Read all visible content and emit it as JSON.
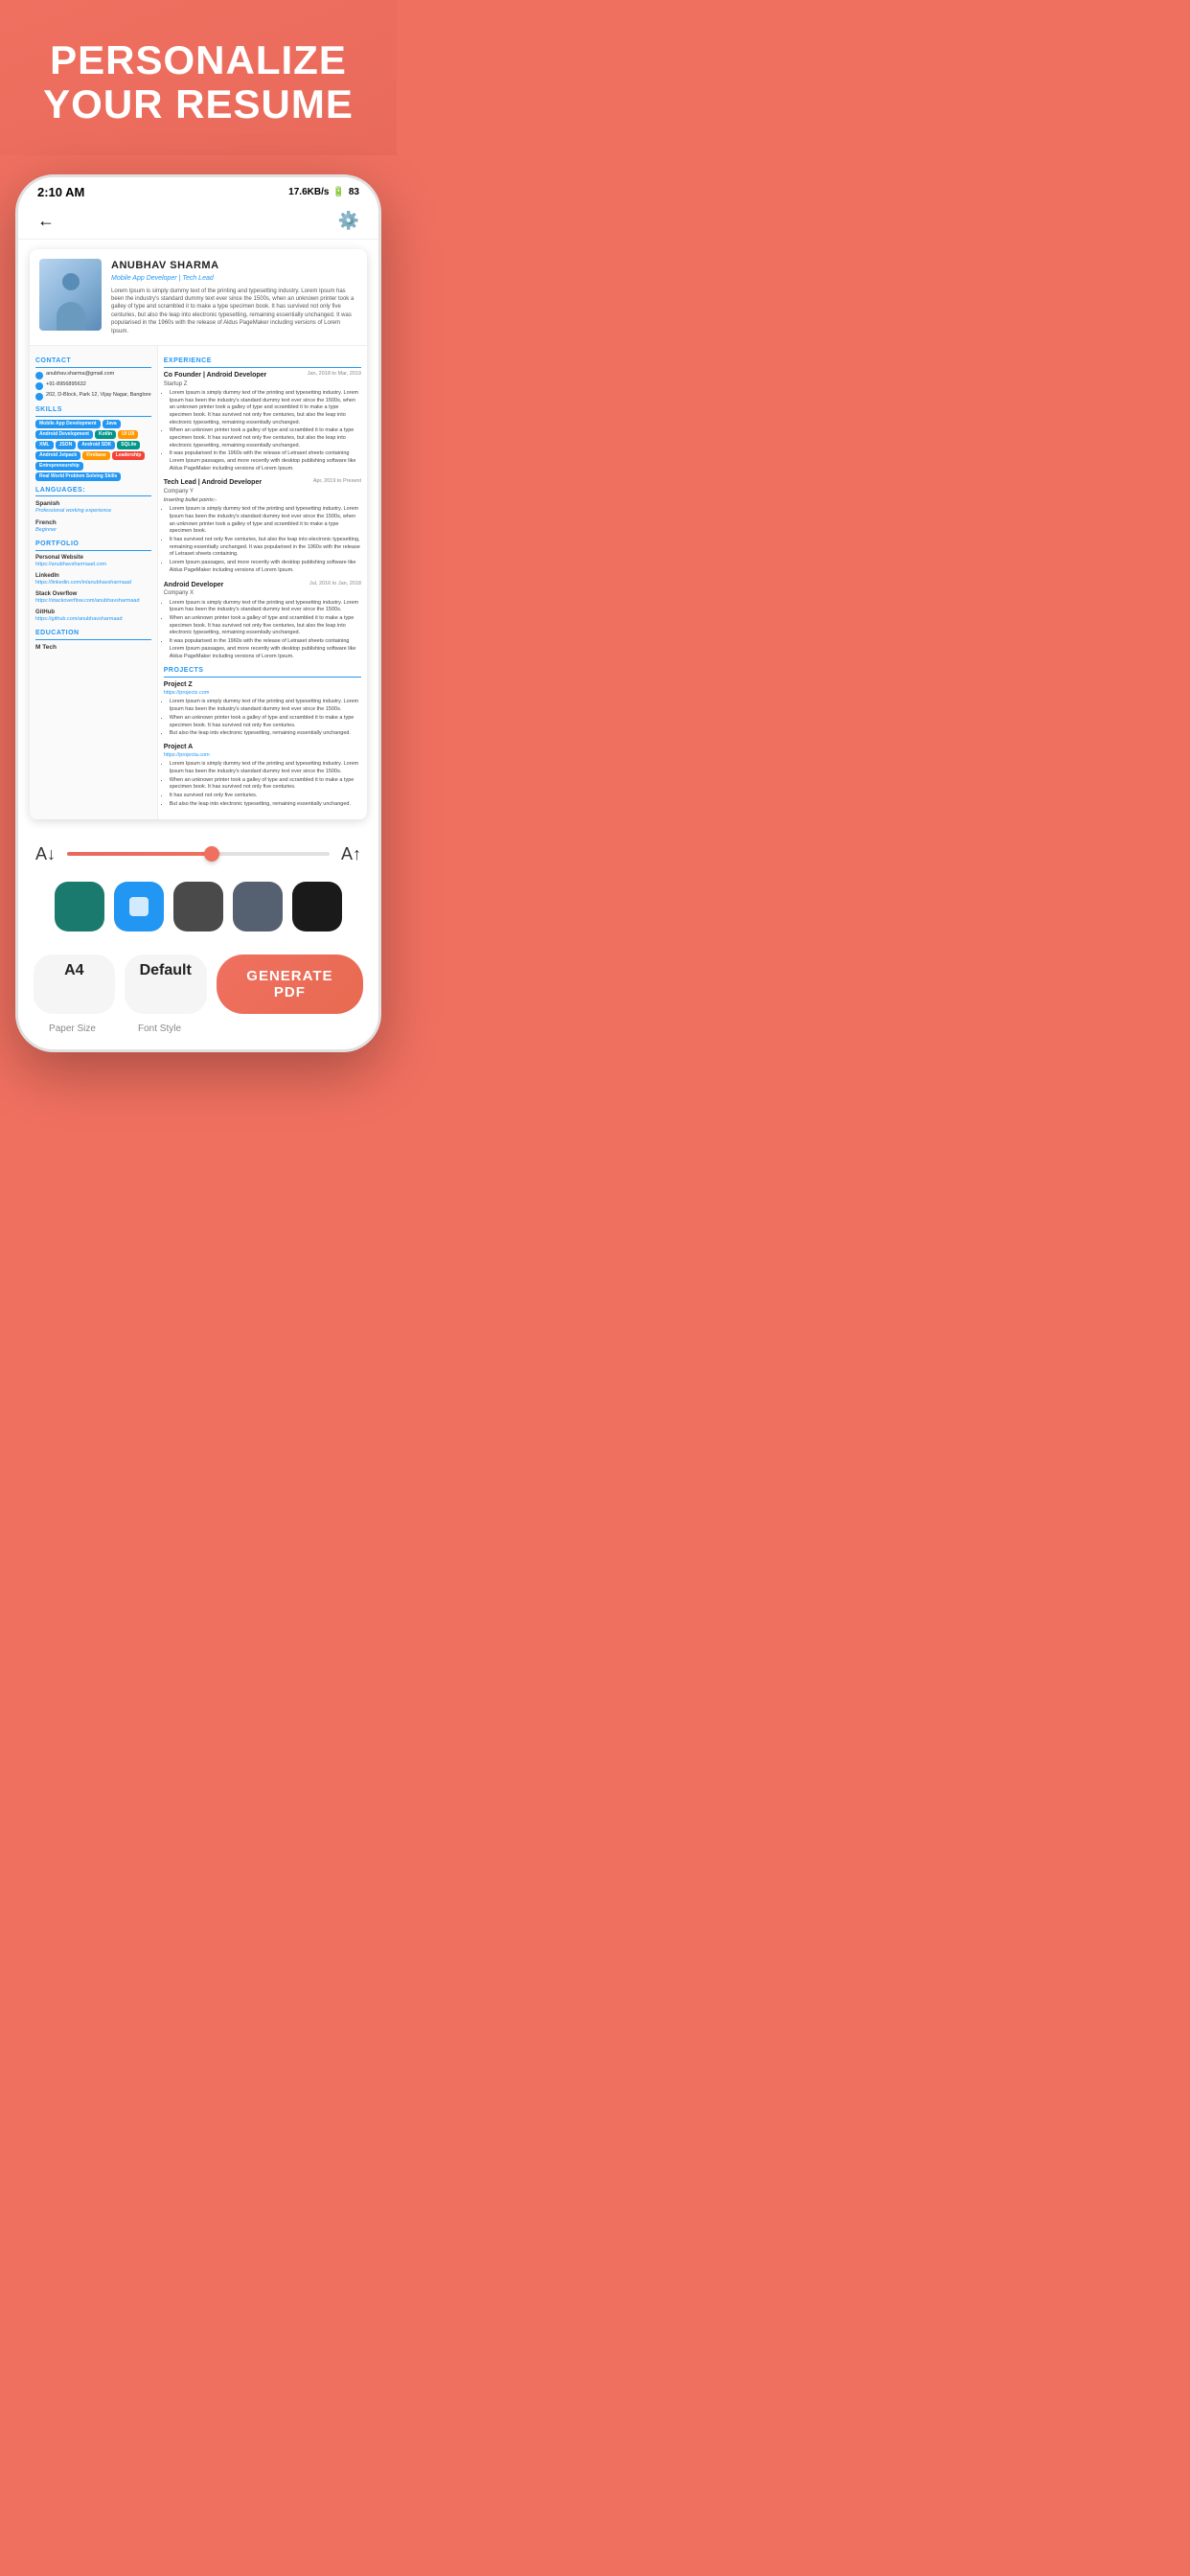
{
  "hero": {
    "title": "PERSONALIZE YOUR RESUME"
  },
  "statusBar": {
    "time": "2:10 AM",
    "speed": "17.6KB/s",
    "battery": "83"
  },
  "resume": {
    "name": "ANUBHAV SHARMA",
    "title": "Mobile App Developer | Tech Lead",
    "summary": "Lorem Ipsum is simply dummy text of the printing and typesetting industry. Lorem Ipsum has been the industry's standard dummy text ever since the 1500s, when an unknown printer took a galley of type and scrambled it to make a type specimen book. It has survived not only five centuries, but also the leap into electronic typesetting, remaining essentially unchanged. It was popularised in the 1960s with the release of Aldus PageMaker including versions of Lorem Ipsum.",
    "contact": {
      "label": "CONTACT",
      "email": "anubhav.sharma@gmail.com",
      "phone": "+91-8956895632",
      "address": "202, D-Block, Park 12, Vijay Nagar, Banglore"
    },
    "skills": {
      "label": "SKILLS",
      "tags": [
        {
          "text": "Mobile App Development",
          "color": "blue"
        },
        {
          "text": "Java",
          "color": "blue"
        },
        {
          "text": "Android Development",
          "color": "blue"
        },
        {
          "text": "Kotlin",
          "color": "teal"
        },
        {
          "text": "UI UX",
          "color": "orange"
        },
        {
          "text": "XML",
          "color": "blue"
        },
        {
          "text": "JSON",
          "color": "blue"
        },
        {
          "text": "Android SDK",
          "color": "blue"
        },
        {
          "text": "SQLite",
          "color": "teal"
        },
        {
          "text": "Android Jetpack",
          "color": "blue"
        },
        {
          "text": "Firebase",
          "color": "orange"
        },
        {
          "text": "Leadership",
          "color": "red"
        },
        {
          "text": "Entrepreneurship",
          "color": "blue"
        },
        {
          "text": "Real World Problem Solving Skills",
          "color": "blue"
        }
      ]
    },
    "languages": {
      "label": "LANGUAGES:",
      "items": [
        {
          "name": "Spanish",
          "level": "Professional working experience"
        },
        {
          "name": "French",
          "level": "Beginner"
        }
      ]
    },
    "portfolio": {
      "label": "PORTFOLIO",
      "items": [
        {
          "label": "Personal Website",
          "link": "https://anubhavsharmaad.com"
        },
        {
          "label": "LinkedIn",
          "link": "https://linkedin.com/in/anubhavsharmaad"
        },
        {
          "label": "Stack Overflow",
          "link": "https://stackoverflow.com/anubhavsharmaad"
        },
        {
          "label": "GitHub",
          "link": "https://github.com/anubhavsharmaad"
        }
      ]
    },
    "education": {
      "label": "EDUCATION",
      "degree": "M Tech"
    },
    "experience": {
      "label": "EXPERIENCE",
      "items": [
        {
          "role": "Co Founder | Android Developer",
          "company": "Startup Z",
          "date": "Jan, 2018 to Mar, 2019",
          "bullets": [
            "Lorem Ipsum is simply dummy text of the printing and typesetting industry. Lorem Ipsum has been the industry's standard dummy text ever since the 1500s, when an unknown printer took a galley of type and scrambled it to make a type specimen book. It has survived not only five centuries, but also the leap into electronic typesetting, remaining essentially unchanged.",
            "When an unknown printer took a galley of type and scrambled it to make a type specimen book. It has survived not only five centuries, but also the leap into electronic typesetting, remaining essentially unchanged.",
            "It was popularised in the 1960s with the release of Letraset sheets containing Lorem Ipsum passages, and more recently with desktop publishing software like Aldus PageMaker including versions of Lorem Ipsum."
          ]
        },
        {
          "role": "Tech Lead | Android Developer",
          "company": "Company Y",
          "date": "Apr, 2019 to Present",
          "note": "Inserting bullet points:-",
          "bullets": [
            "Lorem Ipsum is simply dummy text of the printing and typesetting industry. Lorem Ipsum has been the industry's standard dummy text ever since the 1500s, when an unknown printer took a galley of type and scrambled it to make a type specimen book.",
            "It has survived not only five centuries, but also the leap into electronic typesetting, remaining essentially unchanged. It was popularised in the 1960s with the release of Letraset sheets containing.",
            "Lorem Ipsum passages, and more recently with desktop publishing software like Aldus PageMaker including versions of Lorem Ipsum."
          ]
        },
        {
          "role": "Android Developer",
          "company": "Company X",
          "date": "Jul, 2016 to Jan, 2018",
          "bullets": [
            "Lorem Ipsum is simply dummy text of the printing and typesetting industry. Lorem Ipsum has been the industry's standard dummy text ever since the 1500s.",
            "When an unknown printer took a galley of type and scrambled it to make a type specimen book. It has survived not only five centuries, but also the leap into electronic typesetting, remaining essentially unchanged.",
            "It was popularised in the 1960s with the release of Letraset sheets containing Lorem Ipsum passages, and more recently with desktop publishing software like Aldus PageMaker including versions of Lorem Ipsum."
          ]
        }
      ]
    },
    "projects": {
      "label": "PROJECTS",
      "items": [
        {
          "name": "Project Z",
          "link": "https://projectz.com",
          "bullets": [
            "Lorem Ipsum is simply dummy text of the printing and typesetting industry. Lorem Ipsum has been the industry's standard dummy text ever since the 1500s.",
            "When an unknown printer took a galley of type and scrambled it to make a type specimen book. It has survived not only five centuries.",
            "But also the leap into electronic typesetting, remaining essentially unchanged."
          ]
        },
        {
          "name": "Project A",
          "link": "https://projecta.com",
          "bullets": [
            "Lorem Ipsum is simply dummy text of the printing and typesetting industry. Lorem Ipsum has been the industry's standard dummy text ever since the 1500s.",
            "When an unknown printer took a galley of type and scrambled it to make a type specimen book. It has survived not only five centuries.",
            "It has survived not only five centuries.",
            "But also the leap into electronic typesetting, remaining essentially unchanged."
          ]
        }
      ]
    }
  },
  "controls": {
    "fontSizeDecrease": "A↓",
    "fontSizeIncrease": "A↑",
    "sliderValue": 55,
    "colors": [
      {
        "hex": "#1a7a6e",
        "selected": false
      },
      {
        "hex": "#2196F3",
        "selected": true
      },
      {
        "hex": "#4a4a4a",
        "selected": false
      },
      {
        "hex": "#556070",
        "selected": false
      },
      {
        "hex": "#1a1a1a",
        "selected": false
      }
    ],
    "paperSize": {
      "value": "A4",
      "label": "Paper Size"
    },
    "fontStyle": {
      "value": "Default",
      "label": "Font Style"
    },
    "generateButton": "GENERATE PDF"
  }
}
